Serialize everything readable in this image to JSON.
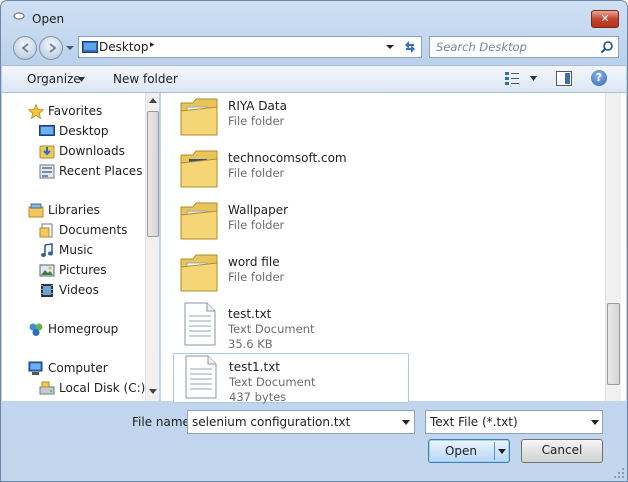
{
  "window": {
    "title": "Open",
    "close_symbol": "✕"
  },
  "address": {
    "path": "Desktop",
    "separator": "▸"
  },
  "search": {
    "placeholder": "Search Desktop"
  },
  "toolbar": {
    "organize_label": "Organize",
    "new_folder_label": "New folder",
    "help_label": "?"
  },
  "nav": {
    "favorites_label": "Favorites",
    "favorites": [
      {
        "label": "Desktop",
        "icon": "desktop-icon"
      },
      {
        "label": "Downloads",
        "icon": "downloads-icon"
      },
      {
        "label": "Recent Places",
        "icon": "recent-places-icon"
      }
    ],
    "libraries_label": "Libraries",
    "libraries": [
      {
        "label": "Documents",
        "icon": "documents-icon"
      },
      {
        "label": "Music",
        "icon": "music-icon"
      },
      {
        "label": "Pictures",
        "icon": "pictures-icon"
      },
      {
        "label": "Videos",
        "icon": "videos-icon"
      }
    ],
    "homegroup_label": "Homegroup",
    "computer_label": "Computer",
    "drives": [
      {
        "label": "Local Disk (C:)",
        "icon": "local-disk-icon"
      }
    ]
  },
  "files": [
    {
      "name": "RIYA Data",
      "type": "File folder",
      "icon": "folder-icon"
    },
    {
      "name": "technocomsoft.com",
      "type": "File folder",
      "icon": "folder-icon"
    },
    {
      "name": "Wallpaper",
      "type": "File folder",
      "icon": "folder-icon"
    },
    {
      "name": "word file",
      "type": "File folder",
      "icon": "folder-icon"
    },
    {
      "name": "test.txt",
      "type": "Text Document",
      "size": "35.6 KB",
      "icon": "text-file-icon"
    },
    {
      "name": "test1.txt",
      "type": "Text Document",
      "size": "437 bytes",
      "icon": "text-file-icon"
    }
  ],
  "bottom": {
    "file_name_label": "File name:",
    "file_name_value": "selenium configuration.txt",
    "file_type_value": "Text File (*.txt)",
    "open_label": "Open",
    "cancel_label": "Cancel"
  },
  "colors": {
    "accent": "#3c7fb1",
    "selection_border": "#a8c8ec",
    "window_frame": "#bcd2ec"
  }
}
